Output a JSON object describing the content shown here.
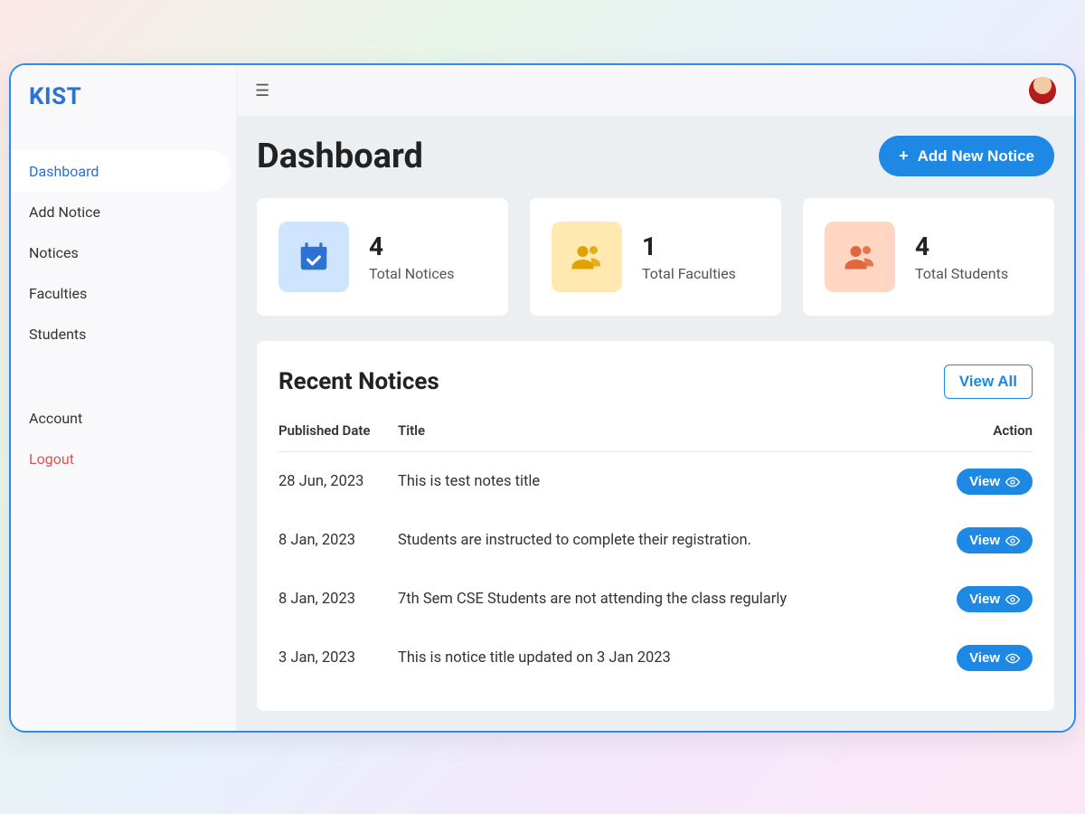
{
  "brand": "KIST",
  "sidebar": {
    "items": [
      {
        "label": "Dashboard",
        "active": true
      },
      {
        "label": "Add Notice"
      },
      {
        "label": "Notices"
      },
      {
        "label": "Faculties"
      },
      {
        "label": "Students"
      }
    ],
    "account_label": "Account",
    "logout_label": "Logout"
  },
  "header": {
    "page_title": "Dashboard",
    "add_button_label": "Add New Notice"
  },
  "stats": [
    {
      "value": "4",
      "label": "Total Notices",
      "icon": "calendar-check-icon",
      "tone": "blue"
    },
    {
      "value": "1",
      "label": "Total Faculties",
      "icon": "users-icon",
      "tone": "yellow"
    },
    {
      "value": "4",
      "label": "Total Students",
      "icon": "users-icon",
      "tone": "orange"
    }
  ],
  "notices": {
    "panel_title": "Recent Notices",
    "view_all_label": "View All",
    "columns": {
      "date": "Published Date",
      "title": "Title",
      "action": "Action"
    },
    "view_label": "View",
    "rows": [
      {
        "date": "28 Jun, 2023",
        "title": "This is test notes title"
      },
      {
        "date": "8 Jan, 2023",
        "title": "Students are instructed to complete their registration."
      },
      {
        "date": "8 Jan, 2023",
        "title": "7th Sem CSE Students are not attending the class regularly"
      },
      {
        "date": "3 Jan, 2023",
        "title": "This is notice title updated on 3 Jan 2023"
      }
    ]
  },
  "colors": {
    "primary": "#1e88e5",
    "danger": "#d9534f"
  }
}
